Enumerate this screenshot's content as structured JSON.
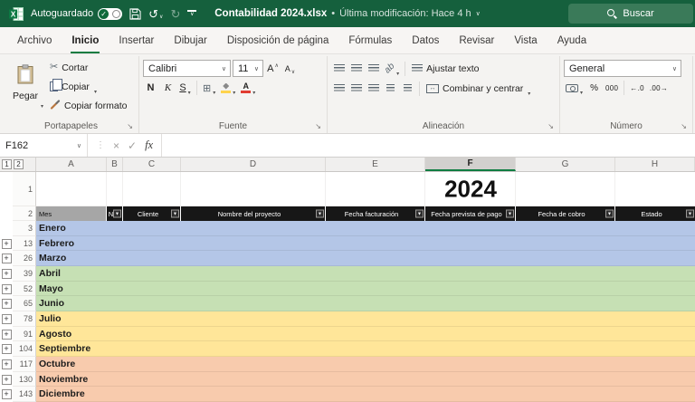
{
  "titlebar": {
    "autosave_label": "Autoguardado",
    "document_title": "Contabilidad 2024.xlsx",
    "separator": "•",
    "last_modified": "Última modificación: Hace 4 h",
    "search_label": "Buscar"
  },
  "menu_tabs": [
    {
      "label": "Archivo"
    },
    {
      "label": "Inicio"
    },
    {
      "label": "Insertar"
    },
    {
      "label": "Dibujar"
    },
    {
      "label": "Disposición de página"
    },
    {
      "label": "Fórmulas"
    },
    {
      "label": "Datos"
    },
    {
      "label": "Revisar"
    },
    {
      "label": "Vista"
    },
    {
      "label": "Ayuda"
    }
  ],
  "ribbon": {
    "clipboard": {
      "group_label": "Portapapeles",
      "paste_label": "Pegar",
      "cut_label": "Cortar",
      "copy_label": "Copiar",
      "format_painter_label": "Copiar formato"
    },
    "font": {
      "group_label": "Fuente",
      "font_family": "Calibri",
      "font_size": "11",
      "size_letter": "A",
      "bold_label": "N",
      "italic_label": "K",
      "underline_label": "S",
      "color_letter": "A"
    },
    "alignment": {
      "group_label": "Alineación",
      "wrap_text_label": "Ajustar texto",
      "merge_center_label": "Combinar y centrar"
    },
    "number": {
      "group_label": "Número",
      "format_value": "General",
      "percent_label": "%",
      "thousands_label": "000",
      "increase_decimal_label": "←.0",
      "decrease_decimal_label": ".00→"
    }
  },
  "formula_bar": {
    "name_box": "F162",
    "fx_label": "fx"
  },
  "sheet": {
    "title": "2024",
    "outline_buttons": [
      "1",
      "2"
    ],
    "columns": [
      "A",
      "B",
      "C",
      "D",
      "E",
      "F",
      "G",
      "H"
    ],
    "selected_column": "F",
    "first_rows": [
      "1",
      "2"
    ],
    "header_row": {
      "mes": "Mes",
      "cells": [
        "N",
        "Cliente",
        "Nombre del proyecto",
        "Fecha facturación",
        "Fecha prevista de pago",
        "Fecha de cobro",
        "Estado"
      ]
    },
    "months": [
      {
        "row": "3",
        "name": "Enero",
        "has_expand": false
      },
      {
        "row": "13",
        "name": "Febrero",
        "has_expand": true
      },
      {
        "row": "26",
        "name": "Marzo",
        "has_expand": true
      },
      {
        "row": "39",
        "name": "Abril",
        "has_expand": true
      },
      {
        "row": "52",
        "name": "Mayo",
        "has_expand": true
      },
      {
        "row": "65",
        "name": "Junio",
        "has_expand": true
      },
      {
        "row": "78",
        "name": "Julio",
        "has_expand": true
      },
      {
        "row": "91",
        "name": "Agosto",
        "has_expand": true
      },
      {
        "row": "104",
        "name": "Septiembre",
        "has_expand": true
      },
      {
        "row": "117",
        "name": "Octubre",
        "has_expand": true
      },
      {
        "row": "130",
        "name": "Noviembre",
        "has_expand": true
      },
      {
        "row": "143",
        "name": "Diciembre",
        "has_expand": true
      }
    ],
    "quarter_colors": {
      "q1": "#b4c6e7",
      "q2": "#c6e0b4",
      "q3": "#ffe699",
      "q4": "#f8cbad"
    },
    "header_bg": "#171717",
    "mes_header_bg": "#a6a6a6"
  },
  "colors": {
    "titlebar": "#15603d",
    "search_pill": "#3a7a59",
    "accent": "#107c41"
  },
  "icons": {
    "toggle_check": "✓",
    "undo": "↺",
    "redo": "↻",
    "scissors": "✂",
    "chevron_down": "▾",
    "chevron_small": "∨",
    "chevron_up": "∧",
    "dialog_launcher": "↘",
    "borders": "⊞",
    "merge_arrows": "↔",
    "orientation_text": "ab",
    "cancel": "×",
    "enter": "✓",
    "dots": "⋮",
    "expand": "+",
    "filter_arrow": "▼"
  }
}
